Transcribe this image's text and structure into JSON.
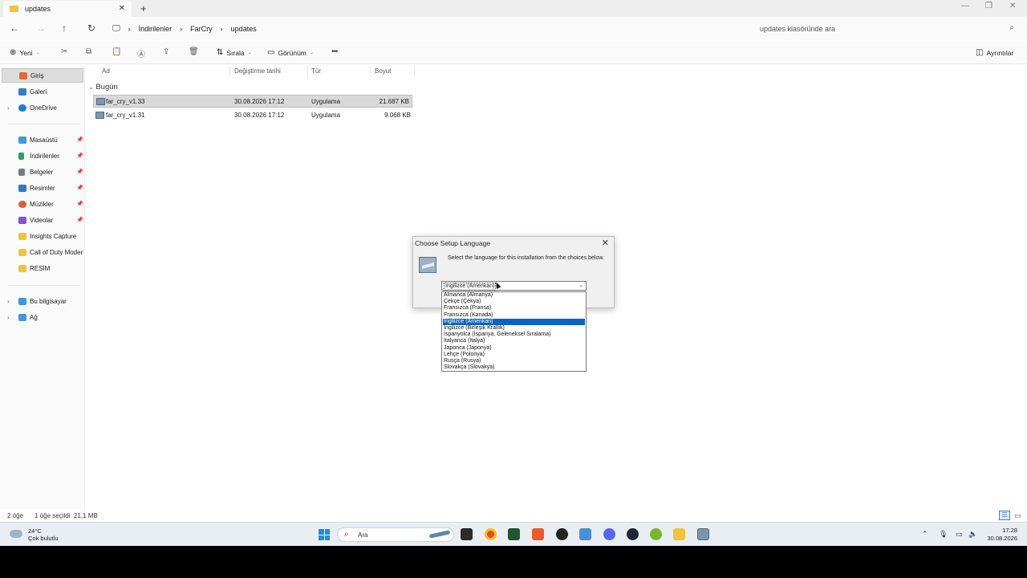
{
  "window": {
    "tab_title": "updates",
    "tab_close": "✕",
    "new_tab": "+",
    "minimize": "—",
    "maximize": "❐",
    "close": "✕"
  },
  "address": {
    "breadcrumbs": [
      "İndirilenler",
      "FarCry",
      "updates"
    ],
    "search_placeholder": "updates klasöründe ara"
  },
  "commandbar": {
    "new_label": "Yeni",
    "sort_label": "Sırala",
    "view_label": "Görünüm",
    "more": "•••",
    "details_label": "Ayrıntılar"
  },
  "sidebar": {
    "items": [
      {
        "label": "Giriş",
        "icon": "home-icon",
        "color": "#e06a3a"
      },
      {
        "label": "Galeri",
        "icon": "gallery-icon",
        "color": "#2f7fc9"
      },
      {
        "label": "OneDrive",
        "icon": "onedrive-icon",
        "color": "#1a7fd9"
      },
      {
        "label": "Masaüstü",
        "icon": "desktop-icon",
        "color": "#3c9ad8"
      },
      {
        "label": "İndirilenler",
        "icon": "download-icon",
        "color": "#26a269"
      },
      {
        "label": "Belgeler",
        "icon": "documents-icon",
        "color": "#6c7d8c"
      },
      {
        "label": "Resimler",
        "icon": "pictures-icon",
        "color": "#2f78c4"
      },
      {
        "label": "Müzikler",
        "icon": "music-icon",
        "color": "#d9603b"
      },
      {
        "label": "Videolar",
        "icon": "videos-icon",
        "color": "#8a4fd6"
      },
      {
        "label": "Insights Capture",
        "icon": "folder-icon",
        "color": "#f3c33c"
      },
      {
        "label": "Call of Duty Moder",
        "icon": "folder-icon",
        "color": "#f3c33c"
      },
      {
        "label": "RESİM",
        "icon": "folder-icon",
        "color": "#f3c33c"
      },
      {
        "label": "Bu bilgisayar",
        "icon": "computer-icon",
        "color": "#3c9ad8"
      },
      {
        "label": "Ağ",
        "icon": "network-icon",
        "color": "#3c9ad8"
      }
    ]
  },
  "filelist": {
    "columns": [
      "Ad",
      "Değiştirme tarihi",
      "Tür",
      "Boyut"
    ],
    "group": "Bugün",
    "rows": [
      {
        "name": "far_cry_v1.33",
        "date": "30.08.2026 17:12",
        "type": "Uygulama",
        "size": "21.687 KB"
      },
      {
        "name": "far_cry_v1.31",
        "date": "30.08.2026 17:12",
        "type": "Uygulama",
        "size": "9.068 KB"
      }
    ]
  },
  "status": {
    "count": "2 öğe",
    "selected": "1 öğe seçildi  21,1 MB"
  },
  "dialog": {
    "title": "Choose Setup Language",
    "close": "✕",
    "message": "Select the language for this installation from the choices below.",
    "selected": "İngilizce (Amerikan)",
    "options": [
      "Almanca (Almanya)",
      "Çekçe (Çekya)",
      "Fransızca (Fransa)",
      "Fransızca (Kanada)",
      "İngilizce (Amerikan)",
      "İngilizce (Birleşik Krallık)",
      "İspanyolca (İspanya, Geleneksel Sıralama)",
      "İtalyanca (İtalya)",
      "Japonca (Japonya)",
      "Lehçe (Polonya)",
      "Rusça (Rusya)",
      "Slovakça (Slovakya)"
    ]
  },
  "taskbar": {
    "temp": "24°C",
    "weather": "Çok bulutlu",
    "search_placeholder": "Ara",
    "time": "17:28",
    "date": "30.08.2026"
  }
}
